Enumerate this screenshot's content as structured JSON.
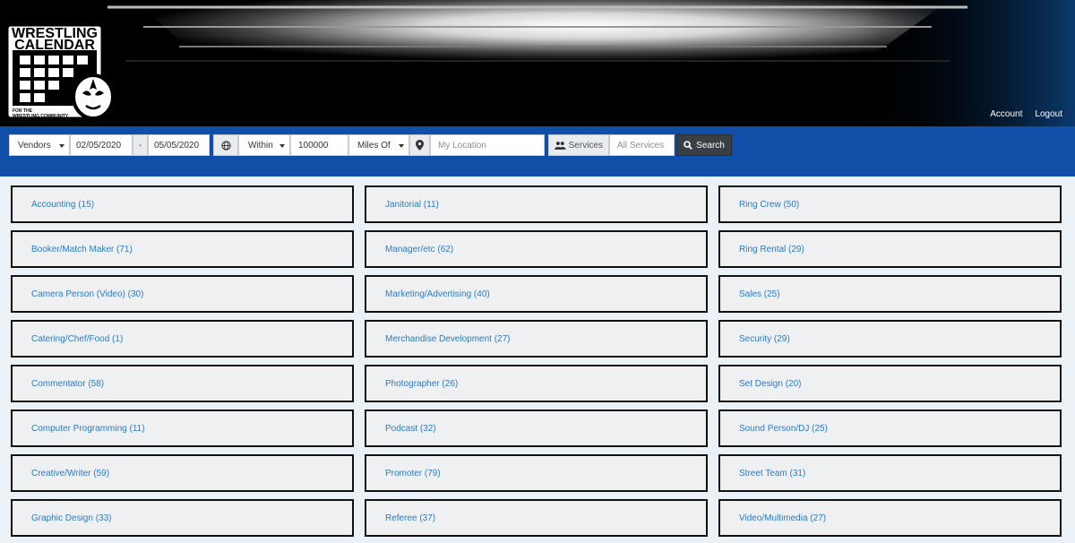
{
  "header": {
    "logo": {
      "line1": "WRESTLING",
      "line2": "CALENDAR",
      "tagline1": "FOR THE",
      "tagline2": "WRESTLING COMMUNITY"
    },
    "links": [
      {
        "label": "Account"
      },
      {
        "label": "Logout"
      }
    ]
  },
  "search": {
    "type_value": "Vendors",
    "date_from": "02/05/2020",
    "date_sep": "-",
    "date_to": "05/05/2020",
    "within_value": "Within",
    "distance_value": "100000",
    "unit_value": "Miles Of",
    "location_placeholder": "My Location",
    "services_label": "Services",
    "services_value": "All Services",
    "search_label": "Search"
  },
  "categories": [
    {
      "label": "Accounting (15)"
    },
    {
      "label": "Janitorial (11)"
    },
    {
      "label": "Ring Crew (50)"
    },
    {
      "label": "Booker/Match Maker (71)"
    },
    {
      "label": "Manager/etc (62)"
    },
    {
      "label": "Ring Rental (29)"
    },
    {
      "label": "Camera Person (Video) (30)"
    },
    {
      "label": "Marketing/Advertising (40)"
    },
    {
      "label": "Sales (25)"
    },
    {
      "label": "Catering/Chef/Food (1)"
    },
    {
      "label": "Merchandise Development (27)"
    },
    {
      "label": "Security (29)"
    },
    {
      "label": "Commentator (58)"
    },
    {
      "label": "Photographer (26)"
    },
    {
      "label": "Set Design (20)"
    },
    {
      "label": "Computer Programming (11)"
    },
    {
      "label": "Podcast (32)"
    },
    {
      "label": "Sound Person/DJ (25)"
    },
    {
      "label": "Creative/Writer (59)"
    },
    {
      "label": "Promoter (79)"
    },
    {
      "label": "Street Team (31)"
    },
    {
      "label": "Graphic Design (33)"
    },
    {
      "label": "Referee (37)"
    },
    {
      "label": "Video/Multimedia (27)"
    }
  ],
  "colors": {
    "header_bg": "#000000",
    "searchbar_bg": "#0f4fa8",
    "link": "#2e7bc4",
    "card_bg": "#eef0f2"
  }
}
